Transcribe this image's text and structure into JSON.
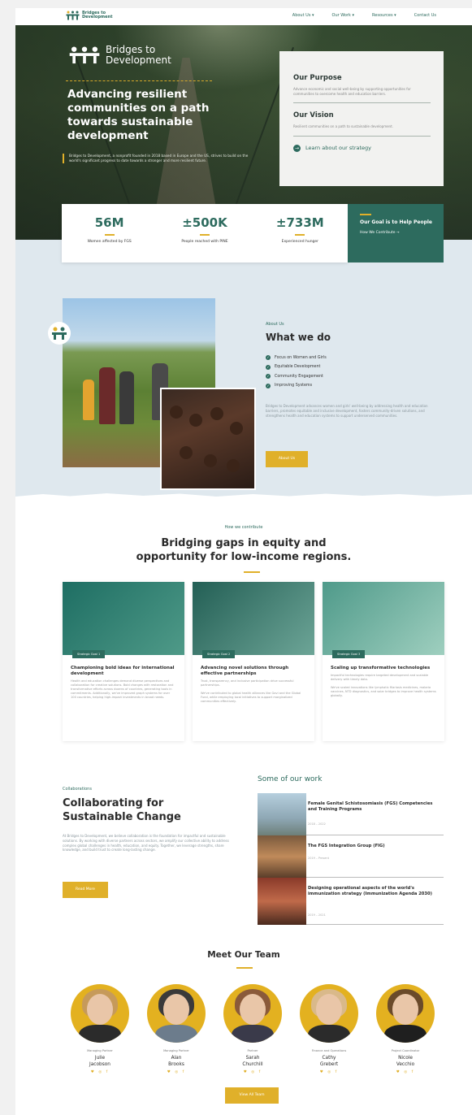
{
  "nav": {
    "logo_text": "Bridges to Development",
    "links": [
      "About Us ▾",
      "Our Work ▾",
      "Resources ▾",
      "Contact Us"
    ]
  },
  "hero": {
    "logo_text": "Bridges to Development",
    "title": "Advancing resilient communities on a path towards sustainable development",
    "description": "Bridges to Development, a nonprofit founded in 2018 based in Europe and the US, strives to build on the world's significant progress to date towards a stronger and more resilient future."
  },
  "purpose": {
    "title": "Our Purpose",
    "text": "Advance economic and social well-being by supporting opportunities for communities to overcome health and education barriers.",
    "vision_title": "Our Vision",
    "vision_text": "Resilient communities on a path to sustainable development.",
    "link": "Learn about our strategy"
  },
  "stats": [
    {
      "value": "56M",
      "label": "Women affected by FGS"
    },
    {
      "value": "±500K",
      "label": "People reached with PINE"
    },
    {
      "value": "±733M",
      "label": "Experienced hunger"
    }
  ],
  "goal": {
    "title": "Our Goal is to Help People",
    "link": "How We Contribute →"
  },
  "about": {
    "eyebrow": "About Us",
    "title": "What we do",
    "items": [
      "Focus on Women and Girls",
      "Equitable Development",
      "Community Engagement",
      "Improving Systems"
    ],
    "description": "Bridges to Development advances women and girls' well-being by addressing health and education barriers, promotes equitable and inclusive development, fosters community-driven solutions, and strengthens health and education systems to support underserved communities.",
    "button": "About Us"
  },
  "contribute": {
    "eyebrow": "How we contribute",
    "title_line1": "Bridging gaps in equity and",
    "title_line2": "opportunity for low-income regions.",
    "cards": [
      {
        "tag": "Strategic Goal 1",
        "title": "Championing bold ideas for international development",
        "p1": "Health and education challenges demand diverse perspectives and collaboration for creative solutions. Bold changes with restoration and transformative efforts across dozens of countries, generating tools in commitments. Additionally, we've improved graph systems for over 100 countries, helping high-impact investments in broad needs."
      },
      {
        "tag": "Strategic Goal 2",
        "title": "Advancing novel solutions through effective partnerships",
        "p1": "Trust, transparency, and inclusive participation drive successful partnerships.",
        "p2": "We've contributed to global health alliances like Gavi and the Global Fund, while employing local initiatives to support marginalized communities effectively."
      },
      {
        "tag": "Strategic Goal 3",
        "title": "Scaling up transformative technologies",
        "p1": "Impactful technologies require targeted development and scalable delivery with timely data.",
        "p2": "We've scaled innovations like lymphatic filariasis medicines, malaria vaccines, NTD diagnostics, and solar bridges to improve health systems globally."
      }
    ]
  },
  "collab": {
    "eyebrow": "Collaborations",
    "title": "Collaborating for Sustainable Change",
    "description": "At Bridges to Development, we believe collaboration is the foundation for impactful and sustainable solutions. By working with diverse partners across sectors, we amplify our collective ability to address complex global challenges in health, education, and equity. Together, we leverage strengths, share knowledge, and build trust to create long-lasting change.",
    "button": "Read More"
  },
  "work": {
    "title": "Some of our work",
    "items": [
      {
        "title": "Female Genital Schistosomiasis (FGS) Competencies and Training Programs",
        "date": "2018 – 2022"
      },
      {
        "title": "The FGS Integration Group (FIG)",
        "date": "2019 – Present"
      },
      {
        "title": "Designing operational aspects of the world's immunization strategy (Immunization Agenda 2030)",
        "date": "2019 – 2021"
      }
    ]
  },
  "team": {
    "title": "Meet Our Team",
    "members": [
      {
        "role": "Managing Partner",
        "name1": "Julie",
        "name2": "Jacobson"
      },
      {
        "role": "Managing Partner",
        "name1": "Alan",
        "name2": "Brooks"
      },
      {
        "role": "Partner",
        "name1": "Sarah",
        "name2": "Churchill"
      },
      {
        "role": "Finance and Operations",
        "name1": "Cathy",
        "name2": "Grebert"
      },
      {
        "role": "Project Coordinator",
        "name1": "Nicole",
        "name2": "Vecchio"
      }
    ],
    "social": "♥ ◎ f",
    "button": "View All Team"
  },
  "colors": {
    "brand_green": "#2d6b5e",
    "accent_yellow": "#e0b02a",
    "about_bg": "#dfe8ee"
  }
}
